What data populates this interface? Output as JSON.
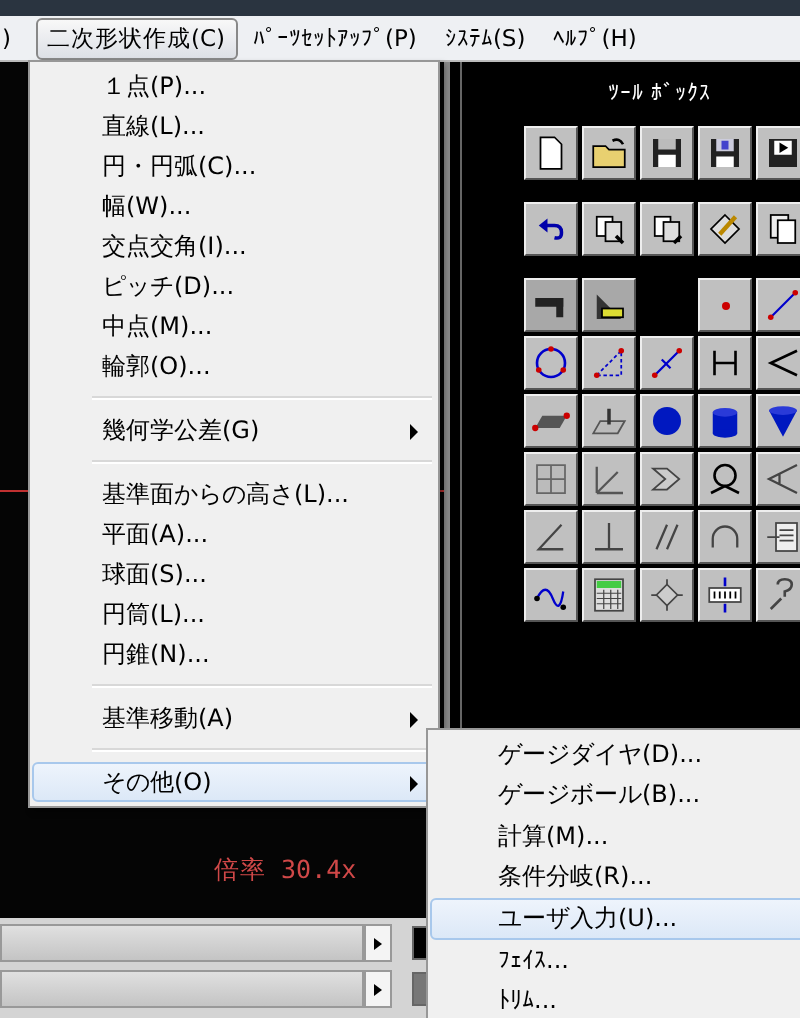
{
  "menu_bar": {
    "items": [
      {
        "label": ")",
        "selected": false
      },
      {
        "label": "二次形状作成(C)",
        "selected": true
      },
      {
        "label": "ﾊﾟｰﾂｾｯﾄｱｯﾌﾟ(P)",
        "selected": false
      },
      {
        "label": "ｼｽﾃﾑ(S)",
        "selected": false
      },
      {
        "label": "ﾍﾙﾌﾟ(H)",
        "selected": false
      }
    ]
  },
  "dropdown_menu": {
    "items": [
      {
        "kind": "item",
        "label": "１点(P)...",
        "highlighted": false
      },
      {
        "kind": "item",
        "label": "直線(L)...",
        "highlighted": false
      },
      {
        "kind": "item",
        "label": "円・円弧(C)...",
        "highlighted": false
      },
      {
        "kind": "item",
        "label": "幅(W)...",
        "highlighted": false
      },
      {
        "kind": "item",
        "label": "交点交角(I)...",
        "highlighted": false
      },
      {
        "kind": "item",
        "label": "ピッチ(D)...",
        "highlighted": false
      },
      {
        "kind": "item",
        "label": "中点(M)...",
        "highlighted": false
      },
      {
        "kind": "item",
        "label": "輪郭(O)...",
        "highlighted": false
      },
      {
        "kind": "separator"
      },
      {
        "kind": "submenu",
        "label": "幾何学公差(G)",
        "highlighted": false
      },
      {
        "kind": "separator"
      },
      {
        "kind": "item",
        "label": "基準面からの高さ(L)...",
        "highlighted": false
      },
      {
        "kind": "item",
        "label": "平面(A)...",
        "highlighted": false
      },
      {
        "kind": "item",
        "label": "球面(S)...",
        "highlighted": false
      },
      {
        "kind": "item",
        "label": "円筒(L)...",
        "highlighted": false
      },
      {
        "kind": "item",
        "label": "円錐(N)...",
        "highlighted": false
      },
      {
        "kind": "separator"
      },
      {
        "kind": "submenu",
        "label": "基準移動(A)",
        "highlighted": false
      },
      {
        "kind": "separator"
      },
      {
        "kind": "submenu",
        "label": "その他(O)",
        "highlighted": true
      }
    ]
  },
  "submenu": {
    "items": [
      {
        "label": "ゲージダイヤ(D)...",
        "highlighted": false
      },
      {
        "label": "ゲージボール(B)...",
        "highlighted": false
      },
      {
        "label": "計算(M)...",
        "highlighted": false
      },
      {
        "label": "条件分岐(R)...",
        "highlighted": false
      },
      {
        "label": "ユーザ入力(U)...",
        "highlighted": true
      },
      {
        "label": "ﾌｪｲｽ...",
        "highlighted": false
      },
      {
        "label": "ﾄﾘﾑ...",
        "highlighted": false
      }
    ]
  },
  "canvas": {
    "zoom_label": "倍率 30.4x"
  },
  "toolbox": {
    "title": "ﾂｰﾙ ﾎﾞｯｸｽ"
  }
}
